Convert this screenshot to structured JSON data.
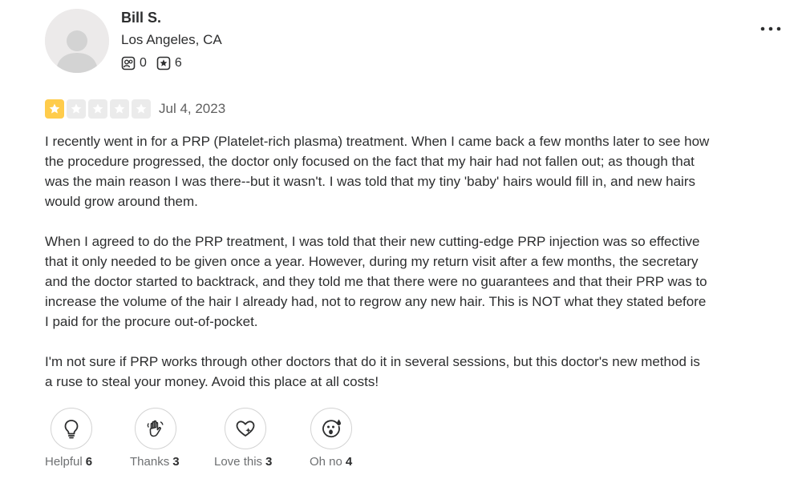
{
  "user": {
    "name": "Bill S.",
    "location": "Los Angeles, CA",
    "friends_count": "0",
    "reviews_count": "6"
  },
  "review": {
    "rating": 1,
    "max_rating": 5,
    "date": "Jul 4, 2023",
    "paragraphs": [
      "I recently went in for a PRP (Platelet-rich plasma) treatment. When I came back a few months later to see how the procedure progressed, the doctor only focused on the fact that my hair had not fallen out; as though that was the main reason I was there--but it wasn't. I was told that my tiny 'baby' hairs would fill in, and new hairs would grow around them.",
      "When I agreed to do the PRP treatment, I was told that their new cutting-edge PRP injection was so effective that it only needed to be given once a year. However, during my return visit after a few months, the secretary and the doctor started to backtrack, and they told me that there were no guarantees and that their PRP was to increase the volume of the hair I already had, not to regrow any new hair. This is NOT what they stated before I paid for the procure out-of-pocket.",
      "I'm not sure if PRP works through other doctors that do it in several sessions, but this doctor's new method is a ruse to steal your money. Avoid this place at all costs!"
    ]
  },
  "reactions": [
    {
      "label": "Helpful",
      "count": "6",
      "icon": "lightbulb-icon"
    },
    {
      "label": "Thanks",
      "count": "3",
      "icon": "waving-hand-icon"
    },
    {
      "label": "Love this",
      "count": "3",
      "icon": "heart-sparkle-icon"
    },
    {
      "label": "Oh no",
      "count": "4",
      "icon": "surprised-face-icon"
    }
  ],
  "colors": {
    "star_filled": "#ffcc4b",
    "star_empty": "#ebebeb",
    "border": "#d3d3d3",
    "muted_text": "#6e7072",
    "text": "#2d2e2f"
  }
}
